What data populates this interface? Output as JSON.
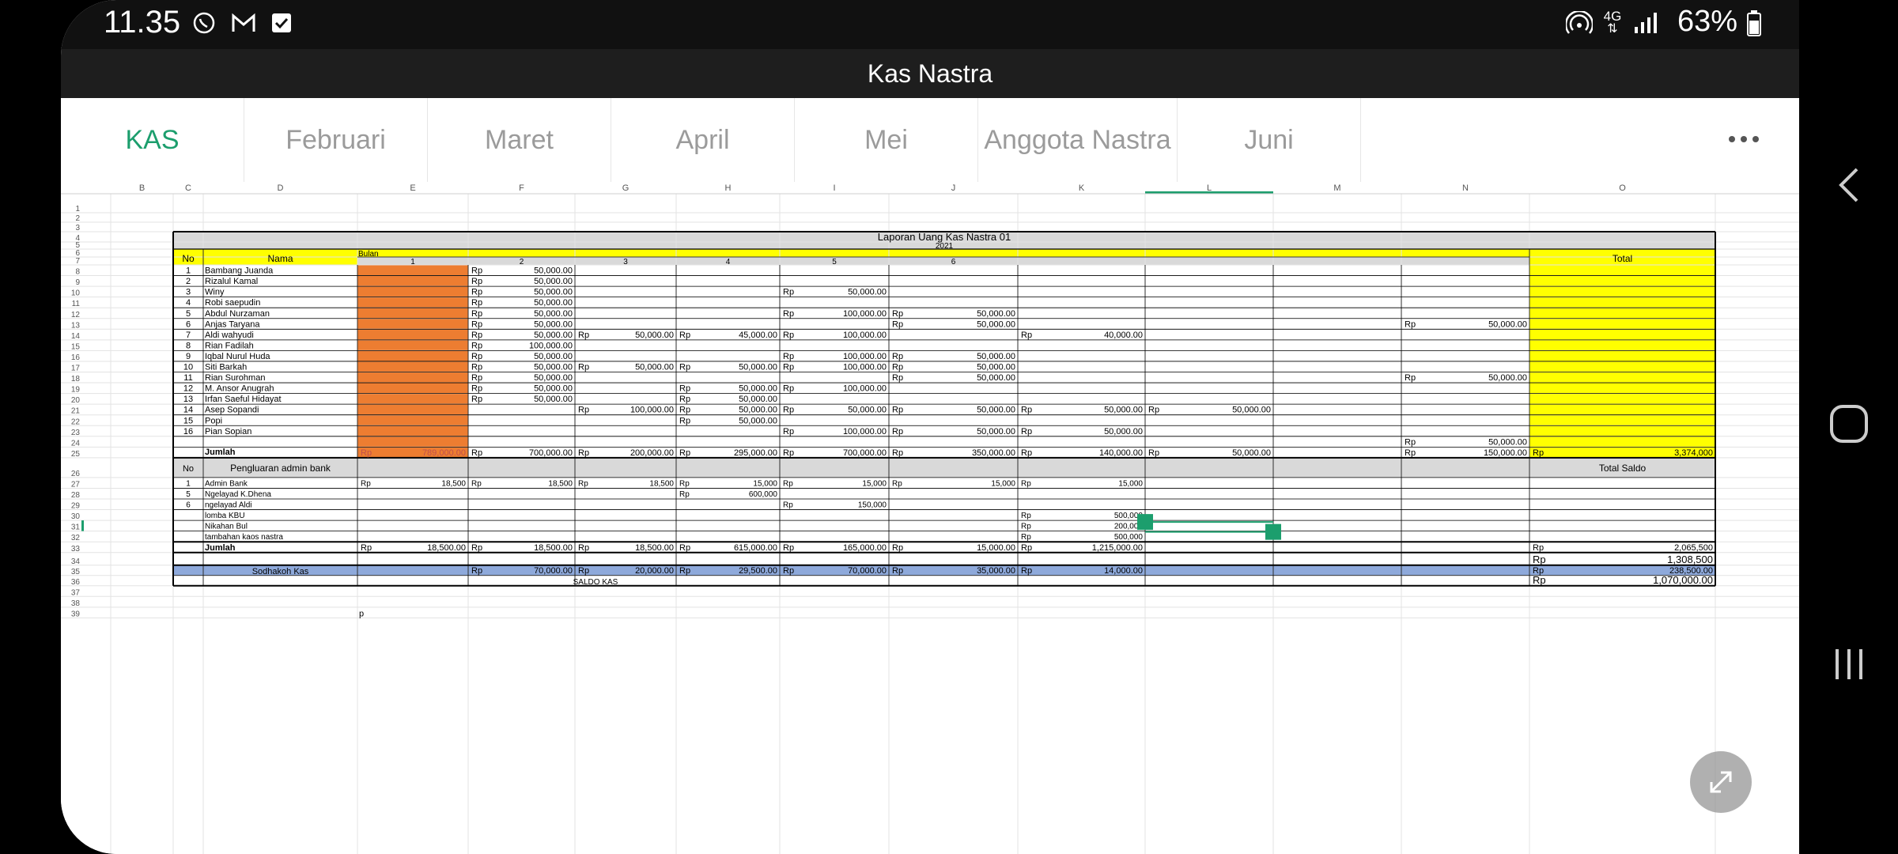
{
  "status_bar": {
    "time": "11.35",
    "notification_icons": [
      "whatsapp-icon",
      "gmail-icon",
      "checkbox-icon"
    ],
    "network_icons": [
      "hotspot-icon",
      "4g-icon",
      "signal-icon"
    ],
    "network_label": "4G",
    "battery_percent": "63%"
  },
  "app": {
    "title": "Kas Nastra"
  },
  "tabs": [
    {
      "label": "KAS",
      "active": true
    },
    {
      "label": "Februari"
    },
    {
      "label": "Maret"
    },
    {
      "label": "April"
    },
    {
      "label": "Mei"
    },
    {
      "label": "Anggota Nastra"
    },
    {
      "label": "Juni"
    }
  ],
  "colors": {
    "accent": "#1c9e6d",
    "yellow": "#ffff00",
    "orange": "#ed7d31",
    "gray": "#d9d9d9",
    "blue": "#8ea9db"
  },
  "sheet": {
    "columns": [
      "B",
      "C",
      "D",
      "E",
      "F",
      "G",
      "H",
      "I",
      "J",
      "K",
      "L",
      "M",
      "N",
      "O"
    ],
    "selected_column": "L",
    "rows": [
      "1",
      "2",
      "3",
      "4",
      "5",
      "6",
      "7",
      "8",
      "9",
      "10",
      "11",
      "12",
      "13",
      "14",
      "15",
      "16",
      "17",
      "18",
      "19",
      "20",
      "21",
      "22",
      "23",
      "24",
      "25",
      "26",
      "27",
      "28",
      "29",
      "30",
      "31",
      "32",
      "33",
      "34",
      "35",
      "36",
      "37",
      "38",
      "39"
    ],
    "title": "Laporan Uang Kas Nastra 01",
    "year": "2021",
    "header": {
      "no": "No",
      "nama": "Nama",
      "bulan": "Bulan",
      "total": "Total"
    },
    "month_numbers": [
      "1",
      "2",
      "3",
      "4",
      "5",
      "6"
    ],
    "currency": "Rp",
    "members": [
      {
        "no": "1",
        "name": "Bambang Juanda",
        "F": "50,000.00"
      },
      {
        "no": "2",
        "name": "Rizalul Kamal",
        "F": "50,000.00"
      },
      {
        "no": "3",
        "name": "Winy",
        "F": "50,000.00",
        "I": "50,000.00"
      },
      {
        "no": "4",
        "name": "Robi saepudin",
        "F": "50,000.00"
      },
      {
        "no": "5",
        "name": "Abdul Nurzaman",
        "F": "50,000.00",
        "I": "100,000.00",
        "J": "50,000.00"
      },
      {
        "no": "6",
        "name": "Anjas Taryana",
        "F": "50,000.00",
        "J": "50,000.00",
        "N": "50,000.00"
      },
      {
        "no": "7",
        "name": "Aldi wahyudi",
        "F": "50,000.00",
        "G": "50,000.00",
        "H": "45,000.00",
        "I": "100,000.00",
        "K": "40,000.00"
      },
      {
        "no": "8",
        "name": "Rian Fadilah",
        "F": "100,000.00"
      },
      {
        "no": "9",
        "name": "Iqbal Nurul Huda",
        "F": "50,000.00",
        "I": "100,000.00",
        "J": "50,000.00"
      },
      {
        "no": "10",
        "name": "Siti Barkah",
        "F": "50,000.00",
        "G": "50,000.00",
        "H": "50,000.00",
        "I": "100,000.00",
        "J": "50,000.00"
      },
      {
        "no": "11",
        "name": "Rian Surohman",
        "F": "50,000.00",
        "J": "50,000.00",
        "N": "50,000.00"
      },
      {
        "no": "12",
        "name": "M. Ansor Anugrah",
        "F": "50,000.00",
        "H": "50,000.00",
        "I": "100,000.00"
      },
      {
        "no": "13",
        "name": "Irfan Saeful Hidayat",
        "F": "50,000.00",
        "H": "50,000.00"
      },
      {
        "no": "14",
        "name": "Asep Sopandi",
        "G": "100,000.00",
        "H": "50,000.00",
        "I": "50,000.00",
        "J": "50,000.00",
        "K": "50,000.00",
        "L": "50,000.00"
      },
      {
        "no": "15",
        "name": "Popi",
        "H": "50,000.00"
      },
      {
        "no": "16",
        "name": "Pian Sopian",
        "I": "100,000.00",
        "J": "50,000.00",
        "K": "50,000.00"
      },
      {
        "no": "",
        "name": "",
        "N": "50,000.00"
      }
    ],
    "jumlah": {
      "label": "Jumlah",
      "E": "789,000.00",
      "F": "700,000.00",
      "G": "200,000.00",
      "H": "295,000.00",
      "I": "700,000.00",
      "J": "350,000.00",
      "K": "140,000.00",
      "L": "50,000.00",
      "N": "150,000.00",
      "O": "3,374,000"
    },
    "expense_header": {
      "no": "No",
      "label": "Pengluaran admin bank",
      "total": "Total Saldo"
    },
    "expenses": [
      {
        "no": "1",
        "name": "Admin Bank",
        "E": "18,500",
        "F": "18,500",
        "G": "18,500",
        "H": "15,000",
        "I": "15,000",
        "J": "15,000",
        "K": "15,000"
      },
      {
        "no": "5",
        "name": "Ngelayad K.Dhena",
        "H": "600,000"
      },
      {
        "no": "6",
        "name": "ngelayad Aldi",
        "I": "150,000"
      },
      {
        "no": "",
        "name": "lomba KBU",
        "K": "500,000"
      },
      {
        "no": "",
        "name": "Nikahan Bul",
        "K": "200,000"
      },
      {
        "no": "",
        "name": "tambahan kaos nastra",
        "K": "500,000"
      }
    ],
    "expense_total": {
      "label": "Jumlah",
      "E": "18,500.00",
      "F": "18,500.00",
      "G": "18,500.00",
      "H": "615,000.00",
      "I": "165,000.00",
      "J": "15,000.00",
      "K": "1,215,000.00",
      "O": "2,065,500"
    },
    "row34": {
      "O": "1,308,500"
    },
    "sodhakoh": {
      "label": "Sodhakoh Kas",
      "F": "70,000.00",
      "G": "20,000.00",
      "H": "29,500.00",
      "I": "70,000.00",
      "J": "35,000.00",
      "K": "14,000.00",
      "O": "238,500.00"
    },
    "saldo": {
      "label": "SALDO KAS",
      "O": "1,070,000.00"
    },
    "stray_cell": "p"
  }
}
